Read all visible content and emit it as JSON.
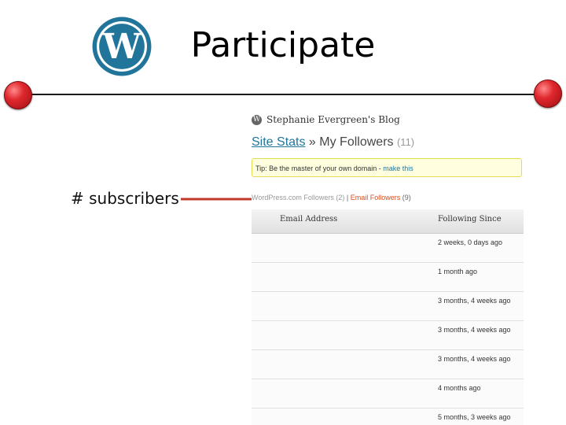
{
  "slide": {
    "title": "Participate",
    "annotation": "# subscribers",
    "accent_color": "#c0392b"
  },
  "screenshot": {
    "blog_name": "Stephanie Evergreen's Blog",
    "heading": {
      "link": "Site Stats",
      "separator": " » ",
      "text": "My Followers",
      "count": "(11)"
    },
    "tip": {
      "text": "Tip: Be the master of your own domain - ",
      "link": "make this"
    },
    "filters": {
      "wordpress": "WordPress.com Followers (2)",
      "divider": " | ",
      "email": "Email Followers",
      "email_count": "(9)"
    },
    "table": {
      "columns": [
        "Email Address",
        "Following Since"
      ],
      "rows": [
        {
          "since": "2 weeks, 0 days ago"
        },
        {
          "since": "1 month ago"
        },
        {
          "since": "3 months, 4 weeks ago"
        },
        {
          "since": "3 months, 4 weeks ago"
        },
        {
          "since": "3 months, 4 weeks ago"
        },
        {
          "since": "4 months ago"
        },
        {
          "since": "5 months, 3 weeks ago"
        }
      ]
    }
  }
}
